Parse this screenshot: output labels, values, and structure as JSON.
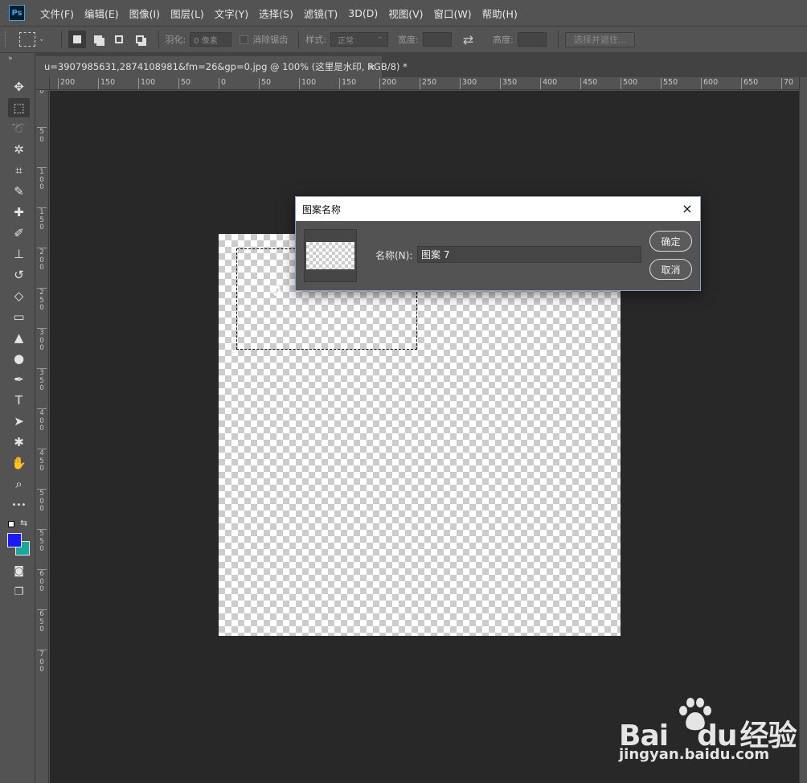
{
  "app": {
    "logo_text": "Ps"
  },
  "menu": [
    "文件(F)",
    "编辑(E)",
    "图像(I)",
    "图层(L)",
    "文字(Y)",
    "选择(S)",
    "滤镜(T)",
    "3D(D)",
    "视图(V)",
    "窗口(W)",
    "帮助(H)"
  ],
  "options": {
    "feather_label": "羽化:",
    "feather_value": "0 像素",
    "antialias_label": "消除锯齿",
    "style_label": "样式:",
    "style_value": "正常",
    "width_label": "宽度:",
    "height_label": "高度:",
    "select_mask_label": "选择并遮住..."
  },
  "document": {
    "tab_title": "u=3907985631,2874108981&fm=26&gp=0.jpg @ 100% (这里是水印, RGB/8) *",
    "tab_close": "×"
  },
  "ruler": {
    "h_labels": [
      "200",
      "150",
      "100",
      "50",
      "0",
      "50",
      "100",
      "150",
      "200",
      "250",
      "300",
      "350",
      "400",
      "450",
      "500",
      "550",
      "600",
      "650",
      "70"
    ],
    "v_labels": [
      "0",
      "50",
      "100",
      "150",
      "200",
      "250",
      "300",
      "350",
      "400",
      "450",
      "500",
      "550",
      "600",
      "650",
      "700"
    ]
  },
  "tools": [
    {
      "name": "move-tool",
      "icon": "✥"
    },
    {
      "name": "marquee-tool",
      "icon": "⬚"
    },
    {
      "name": "lasso-tool",
      "icon": "➰"
    },
    {
      "name": "magic-wand-tool",
      "icon": "✲"
    },
    {
      "name": "crop-tool",
      "icon": "⌗"
    },
    {
      "name": "eyedropper-tool",
      "icon": "✎"
    },
    {
      "name": "healing-brush-tool",
      "icon": "✚"
    },
    {
      "name": "brush-tool",
      "icon": "✐"
    },
    {
      "name": "clone-stamp-tool",
      "icon": "⊥"
    },
    {
      "name": "history-brush-tool",
      "icon": "↺"
    },
    {
      "name": "eraser-tool",
      "icon": "◇"
    },
    {
      "name": "gradient-tool",
      "icon": "▭"
    },
    {
      "name": "blur-tool",
      "icon": "▲"
    },
    {
      "name": "dodge-tool",
      "icon": "●"
    },
    {
      "name": "pen-tool",
      "icon": "✒"
    },
    {
      "name": "type-tool",
      "icon": "T"
    },
    {
      "name": "path-selection-tool",
      "icon": "➤"
    },
    {
      "name": "shape-tool",
      "icon": "✱"
    },
    {
      "name": "hand-tool",
      "icon": "✋"
    },
    {
      "name": "zoom-tool",
      "icon": "⌕"
    },
    {
      "name": "more-tools",
      "icon": "•••"
    }
  ],
  "colors": {
    "foreground": "#1a1aff",
    "background": "#1aa89a"
  },
  "dialog": {
    "title": "图案名称",
    "close": "×",
    "name_label": "名称(N):",
    "name_value": "图案 7",
    "ok_label": "确定",
    "cancel_label": "取消"
  },
  "watermark": {
    "brand": "Bai",
    "brand_suffix": "du",
    "brand_cn": "经验",
    "url": "jingyan.baidu.com"
  }
}
